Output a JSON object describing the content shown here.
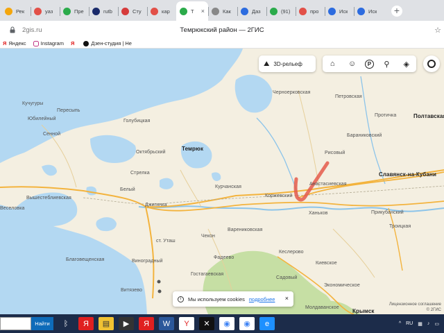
{
  "browser": {
    "tabs": [
      {
        "label": "Рек",
        "color": "#f4a60d"
      },
      {
        "label": "yaз",
        "color": "#e25048"
      },
      {
        "label": "Пре",
        "color": "#2bab4b"
      },
      {
        "label": "rutb",
        "color": "#1b2b6b"
      },
      {
        "label": "Сту",
        "color": "#d63b3b"
      },
      {
        "label": "кар",
        "color": "#e25048"
      },
      {
        "label": "Т",
        "color": "#2bab4b"
      },
      {
        "label": "Как",
        "color": "#888888"
      },
      {
        "label": "Даз",
        "color": "#2d6cdf"
      },
      {
        "label": "(91)",
        "color": "#2bab4b"
      },
      {
        "label": "про",
        "color": "#e25048"
      },
      {
        "label": "Иск",
        "color": "#2d6cdf"
      },
      {
        "label": "Иск",
        "color": "#2d6cdf"
      }
    ],
    "active_tab_close": "×",
    "new_tab": "+",
    "url": "2gis.ru",
    "page_title": "Темрюкский район — 2ГИС",
    "bookmarks": [
      {
        "label": "Яндекс",
        "icon": "yandex-icon"
      },
      {
        "label": "Instagram",
        "icon": "instagram-icon"
      },
      {
        "label": "Я",
        "icon": "yandex-icon"
      },
      {
        "label": "Дзен-студия | Не",
        "icon": "dzen-icon"
      }
    ]
  },
  "map": {
    "relief_button": "3D-рельеф",
    "controls": [
      "directions-icon",
      "people-icon",
      "parking-icon",
      "pin-icon",
      "layers-icon"
    ],
    "cookie_text": "Мы используем cookies",
    "cookie_link": "подробнее",
    "cookie_close": "×",
    "attribution_line1": "Лицензионное соглашение",
    "attribution_line2": "© 2ГИС",
    "places": [
      {
        "name": "Кучугуры",
        "style": "normal"
      },
      {
        "name": "Пересыпь",
        "style": "normal"
      },
      {
        "name": "Юбилейный",
        "style": "normal"
      },
      {
        "name": "Сенной",
        "style": "normal"
      },
      {
        "name": "Голубицкая",
        "style": "normal"
      },
      {
        "name": "Октябрьский",
        "style": "normal"
      },
      {
        "name": "Темрюк",
        "style": "big"
      },
      {
        "name": "Стрелка",
        "style": "normal"
      },
      {
        "name": "Курчанская",
        "style": "normal"
      },
      {
        "name": "Вышестеблиевская",
        "style": "normal"
      },
      {
        "name": "Белый",
        "style": "normal"
      },
      {
        "name": "Джигинка",
        "style": "normal"
      },
      {
        "name": "Веселовка",
        "style": "normal"
      },
      {
        "name": "Благовещенская",
        "style": "normal"
      },
      {
        "name": "Виноградный",
        "style": "normal"
      },
      {
        "name": "Витязево",
        "style": "normal"
      },
      {
        "name": "Чекон",
        "style": "normal"
      },
      {
        "name": "Фадеево",
        "style": "normal"
      },
      {
        "name": "Гостагаевская",
        "style": "normal"
      },
      {
        "name": "Варениковская",
        "style": "normal"
      },
      {
        "name": "Кеслерово",
        "style": "normal"
      },
      {
        "name": "Садовый",
        "style": "normal"
      },
      {
        "name": "Киевское",
        "style": "normal"
      },
      {
        "name": "Экономическое",
        "style": "normal"
      },
      {
        "name": "Молдаванское",
        "style": "normal"
      },
      {
        "name": "Крымск",
        "style": "big"
      },
      {
        "name": "Черноерковская",
        "style": "normal"
      },
      {
        "name": "Петровская",
        "style": "normal"
      },
      {
        "name": "Протичка",
        "style": "normal"
      },
      {
        "name": "Полтавская",
        "style": "big"
      },
      {
        "name": "Бараниковский",
        "style": "normal"
      },
      {
        "name": "Рисовый",
        "style": "normal"
      },
      {
        "name": "Славянск-на-Кубани",
        "style": "big"
      },
      {
        "name": "Анастасиевская",
        "style": "normal"
      },
      {
        "name": "Коржевский",
        "style": "normal"
      },
      {
        "name": "Ханьков",
        "style": "normal"
      },
      {
        "name": "Прикубанский",
        "style": "normal"
      },
      {
        "name": "Троицкая",
        "style": "normal"
      },
      {
        "name": "ст. Уташ",
        "style": "normal"
      }
    ]
  },
  "taskbar": {
    "search_button": "Найти",
    "apps": [
      "bluetooth-icon",
      "yandex-icon",
      "file-explorer-icon",
      "media-player-icon",
      "yandex-icon",
      "word-icon",
      "yandex-browser-icon",
      "capcut-icon",
      "chrome-icon",
      "chrome-icon",
      "internet-explorer-icon"
    ],
    "lang": "RU"
  },
  "colors": {
    "water": "#b3d8f2",
    "land": "#f4efe1",
    "green": "#c6dfa4",
    "road": "#f3b33d",
    "annotation": "#e45a4b",
    "taskbar": "#1c2c4a"
  }
}
